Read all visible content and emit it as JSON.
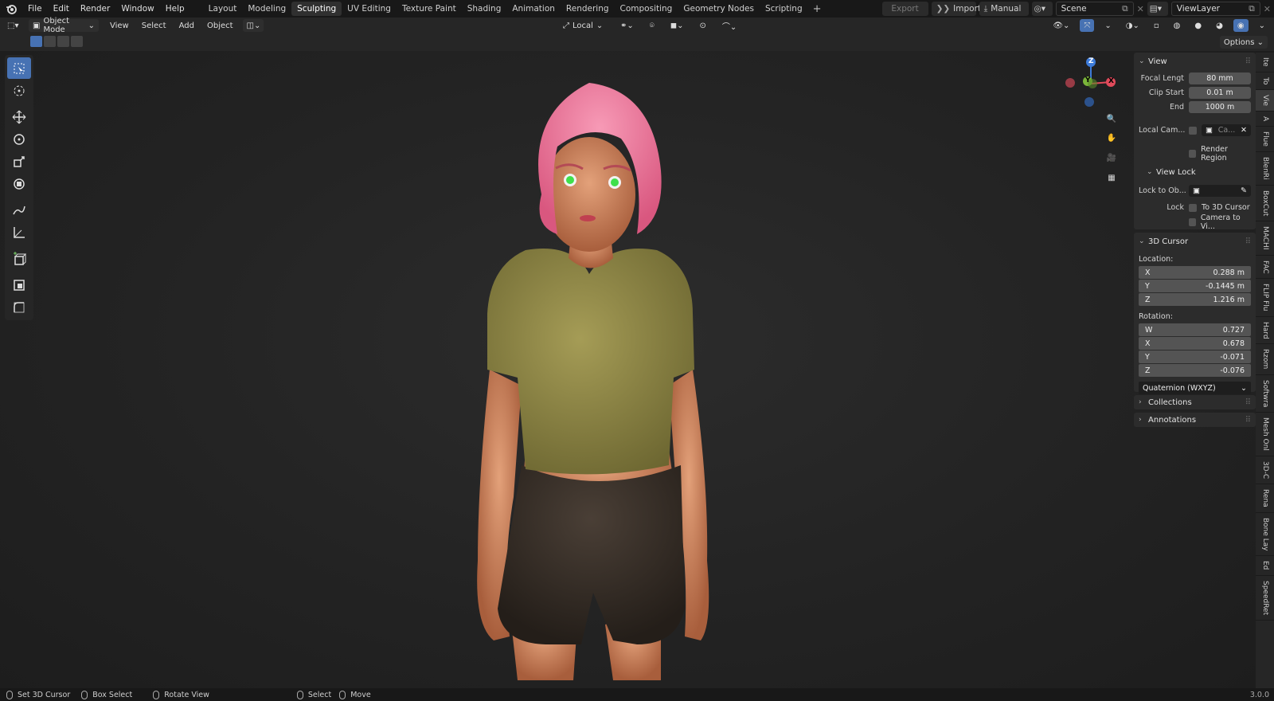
{
  "topbar": {
    "menus": [
      "File",
      "Edit",
      "Render",
      "Window",
      "Help"
    ],
    "workspaces": [
      "Layout",
      "Modeling",
      "Sculpting",
      "UV Editing",
      "Texture Paint",
      "Shading",
      "Animation",
      "Rendering",
      "Compositing",
      "Geometry Nodes",
      "Scripting"
    ],
    "active_workspace": "Sculpting",
    "add_workspace": "+",
    "export_label": "Export",
    "import_label": "Import",
    "manual_label": "Manual",
    "scene_name": "Scene",
    "view_layer": "ViewLayer"
  },
  "header": {
    "mode": "Object Mode",
    "menus": [
      "View",
      "Select",
      "Add",
      "Object"
    ],
    "transform_orientation": "Local",
    "options_label": "Options"
  },
  "npanel": {
    "view": {
      "title": "View",
      "focal_length_label": "Focal Lengt",
      "focal_length": "80 mm",
      "clip_start_label": "Clip Start",
      "clip_start": "0.01 m",
      "clip_end_label": "End",
      "clip_end": "1000 m",
      "local_camera_label": "Local Cam...",
      "local_camera_value": "Ca...",
      "render_region_label": "Render Region",
      "view_lock_title": "View Lock",
      "lock_to_object_label": "Lock to Ob...",
      "lock_label": "Lock",
      "to_3d_cursor_label": "To 3D Cursor",
      "camera_to_view_label": "Camera to Vi..."
    },
    "cursor": {
      "title": "3D Cursor",
      "location_label": "Location:",
      "loc_x": "0.288 m",
      "loc_y": "-0.1445 m",
      "loc_z": "1.216 m",
      "rotation_label": "Rotation:",
      "rot_w": "0.727",
      "rot_x": "0.678",
      "rot_y": "-0.071",
      "rot_z": "-0.076",
      "rotation_mode": "Quaternion (WXYZ)"
    },
    "collections_title": "Collections",
    "annotations_title": "Annotations"
  },
  "side_tabs": [
    "Ite",
    "To",
    "Vie",
    "A",
    "Flue",
    "BlenRi",
    "BoxCut",
    "MACHI",
    "FAC",
    "FLIP Flu",
    "Hard",
    "Rzom",
    "Softwra",
    "Mesh Onl",
    "3D-C",
    "Rena",
    "Bone Lay",
    "Ed",
    "SpeedRet"
  ],
  "gizmo": {
    "x": "X",
    "y": "Y",
    "z": "Z"
  },
  "status": {
    "set_cursor": "Set 3D Cursor",
    "box_select": "Box Select",
    "rotate_view": "Rotate View",
    "select": "Select",
    "move": "Move",
    "version": "3.0.0"
  },
  "colors": {
    "accent": "#4772b3",
    "axis_x": "#e04a5a",
    "axis_y": "#7bb53a",
    "axis_z": "#3d7bd9",
    "hair": "#f07aa0",
    "shirt": "#8b8440",
    "shorts": "#3a322c",
    "skin": "#d9936c"
  }
}
